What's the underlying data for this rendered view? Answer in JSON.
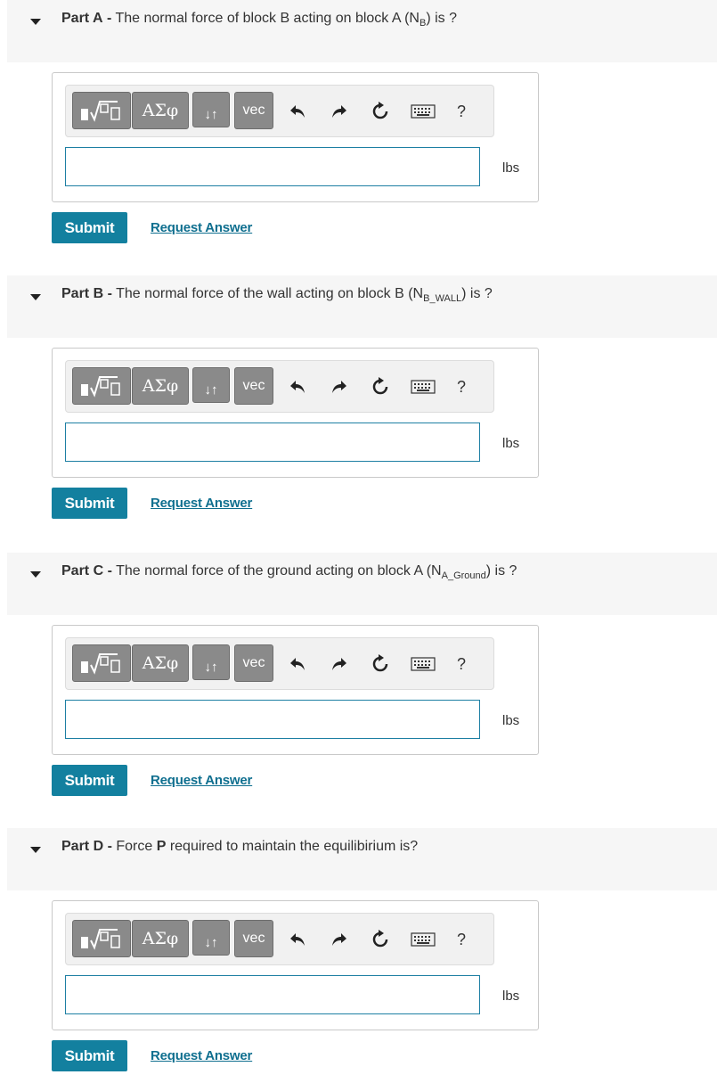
{
  "parts": [
    {
      "label": "Part A",
      "sep": "-",
      "text_before": "The normal force of block B acting on block A (N",
      "subscript": "B",
      "text_after": ") is ?",
      "unit": "lbs",
      "answer_value": "",
      "submit_label": "Submit",
      "request_label": "Request Answer"
    },
    {
      "label": "Part B",
      "sep": "-",
      "text_before": "The normal force of the wall acting on block B (N",
      "subscript": "B_WALL",
      "text_after": ") is ?",
      "unit": "lbs",
      "answer_value": "",
      "submit_label": "Submit",
      "request_label": "Request Answer"
    },
    {
      "label": "Part C",
      "sep": "-",
      "text_before": "The normal force of the ground acting on block A (N",
      "subscript": "A_Ground",
      "text_after": ") is ?",
      "unit": "lbs",
      "answer_value": "",
      "submit_label": "Submit",
      "request_label": "Request Answer"
    },
    {
      "label": "Part D",
      "sep": "-",
      "text_before": "Force ",
      "bold_word": "P",
      "text_after": " required to maintain the equilibirium is?",
      "unit": "lbs",
      "answer_value": "",
      "submit_label": "Submit",
      "request_label": "Request Answer"
    }
  ],
  "toolbar": {
    "templates_icon": "fraction-root-template-icon",
    "greek_label": "ΑΣφ",
    "arrows_label": "↓↑",
    "vec_label": "vec",
    "undo_icon": "undo-icon",
    "redo_icon": "redo-icon",
    "reset_icon": "reset-icon",
    "keyboard_icon": "keyboard-icon",
    "help_label": "?"
  },
  "colors": {
    "submit_bg": "#13809f",
    "link": "#0f6f8f",
    "header_bg": "#f6f6f6",
    "toolbar_btn": "#8a8a8a",
    "input_border": "#1d7fa3"
  }
}
